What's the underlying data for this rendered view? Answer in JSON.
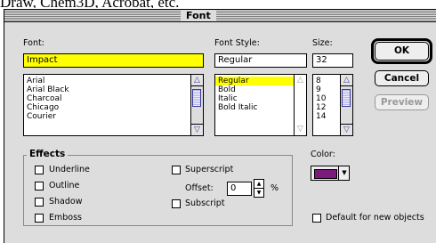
{
  "background_text": "Draw, Chem3D, Acrobat, etc.",
  "dialog": {
    "title": "Font",
    "font": {
      "label": "Font:",
      "value": "Impact",
      "items": [
        "Arial",
        "Arial Black",
        "Charcoal",
        "Chicago",
        "Courier"
      ]
    },
    "style": {
      "label": "Font Style:",
      "value": "Regular",
      "items": [
        "Regular",
        "Bold",
        "Italic",
        "Bold Italic"
      ],
      "selected": "Regular"
    },
    "size": {
      "label": "Size:",
      "value": "32",
      "items": [
        "8",
        "9",
        "10",
        "12",
        "14"
      ]
    },
    "buttons": {
      "ok": "OK",
      "cancel": "Cancel",
      "preview": "Preview"
    },
    "effects": {
      "label": "Effects",
      "underline": "Underline",
      "outline": "Outline",
      "shadow": "Shadow",
      "emboss": "Emboss",
      "superscript": "Superscript",
      "offset_label": "Offset:",
      "offset_value": "0",
      "offset_unit": "%",
      "subscript": "Subscript"
    },
    "color": {
      "label": "Color:",
      "swatch": "#7a1a7a"
    },
    "default_checkbox": "Default for new objects",
    "colors": {
      "highlight": "#ffff00",
      "dialog_bg": "#dddddd",
      "scroll_accent": "#3b3b9a"
    }
  }
}
